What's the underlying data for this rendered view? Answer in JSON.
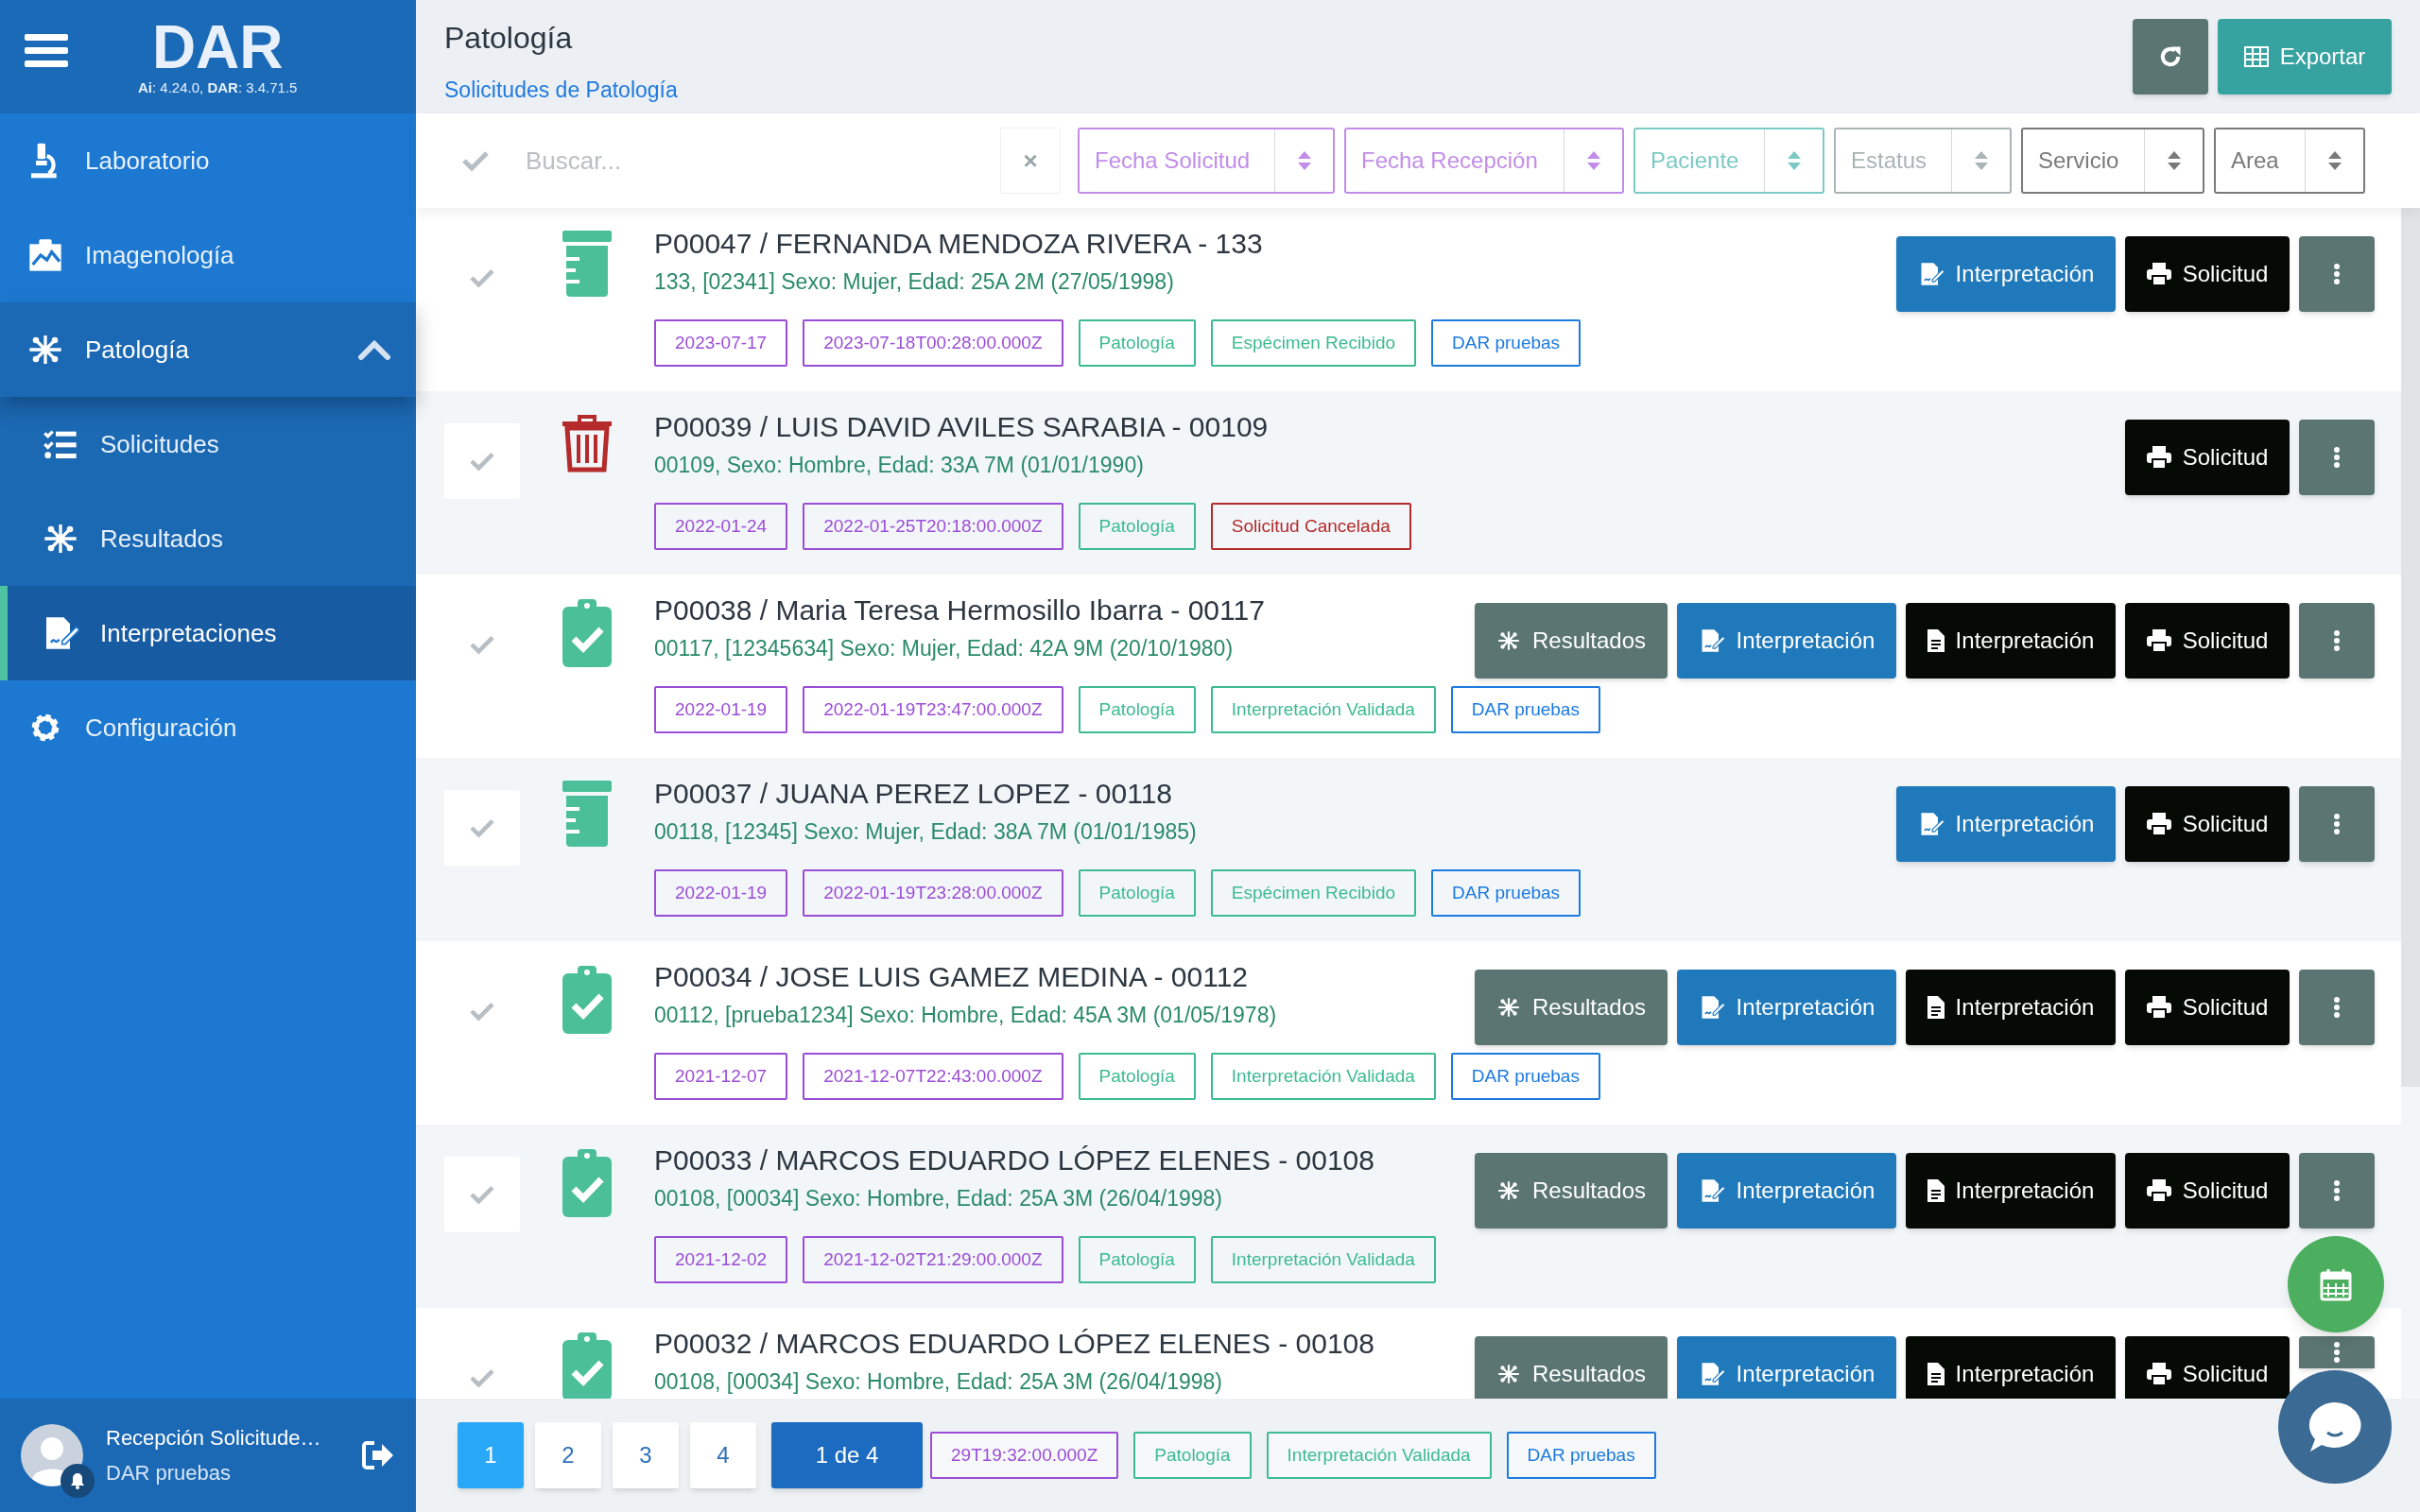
{
  "sidebar": {
    "logo": "DAR",
    "version": "**Ai**: 4.24.0, **DAR**: 3.4.71.5",
    "items": [
      {
        "kind": "laboratory",
        "label": "Laboratorio",
        "selected": false
      },
      {
        "kind": "imaging",
        "label": "Imagenología",
        "selected": false
      },
      {
        "kind": "pathology",
        "label": "Patología",
        "selected": false,
        "expanded": true,
        "children": [
          {
            "kind": "requests",
            "label": "Solicitudes",
            "selected": false
          },
          {
            "kind": "results",
            "label": "Resultados",
            "selected": false
          },
          {
            "kind": "interpretations",
            "label": "Interpretaciones",
            "selected": true
          }
        ]
      },
      {
        "kind": "settings",
        "label": "Configuración",
        "selected": false
      }
    ],
    "user": {
      "name": "Recepción Solicitude…",
      "group": "DAR pruebas"
    }
  },
  "header": {
    "title": "Patología",
    "breadcrumb": "Solicitudes de Patología",
    "export_label": "Exportar"
  },
  "filters": {
    "search_placeholder": "Buscar...",
    "clear": "×",
    "sorts": [
      {
        "label": "Fecha Solicitud",
        "color": "#c28de8"
      },
      {
        "label": "Fecha Recepción",
        "color": "#c28de8"
      },
      {
        "label": "Paciente",
        "color": "#7ccac5"
      },
      {
        "label": "Estatus",
        "color": "#aab4b4"
      },
      {
        "label": "Servicio",
        "color": "#7a7a7a"
      },
      {
        "label": "Area",
        "color": "#7a7a7a"
      }
    ]
  },
  "rows": [
    {
      "kind": "specimen",
      "checked": false,
      "title": "P00047 / FERNANDA MENDOZA RIVERA - 133",
      "subtitle": "133, [02341] Sexo: Mujer, Edad: 25A 2M (27/05/1998)",
      "tags": [
        {
          "text": "2023-07-17",
          "color": "#9b4dd6"
        },
        {
          "text": "2023-07-18T00:28:00.000Z",
          "color": "#9b4dd6"
        },
        {
          "text": "Patología",
          "color": "#3dbb92"
        },
        {
          "text": "Espécimen Recibido",
          "color": "#3dbb92"
        },
        {
          "text": "DAR pruebas",
          "color": "#1d7ae0"
        }
      ],
      "buttons": [
        {
          "kind": "interpret",
          "label": "Interpretación"
        },
        {
          "kind": "request",
          "label": "Solicitud"
        },
        {
          "kind": "more"
        }
      ]
    },
    {
      "kind": "cancelled",
      "checked": false,
      "title": "P00039 / LUIS DAVID AVILES SARABIA - 00109",
      "subtitle": "00109, Sexo: Hombre, Edad: 33A 7M (01/01/1990)",
      "tags": [
        {
          "text": "2022-01-24",
          "color": "#9b4dd6"
        },
        {
          "text": "2022-01-25T20:18:00.000Z",
          "color": "#9b4dd6"
        },
        {
          "text": "Patología",
          "color": "#3dbb92"
        },
        {
          "text": "Solicitud Cancelada",
          "color": "#b52a2a"
        }
      ],
      "buttons": [
        {
          "kind": "request",
          "label": "Solicitud"
        },
        {
          "kind": "more"
        }
      ]
    },
    {
      "kind": "validated",
      "checked": false,
      "title": "P00038 / Maria Teresa Hermosillo Ibarra - 00117",
      "subtitle": "00117, [12345634] Sexo: Mujer, Edad: 42A 9M (20/10/1980)",
      "tags": [
        {
          "text": "2022-01-19",
          "color": "#9b4dd6"
        },
        {
          "text": "2022-01-19T23:47:00.000Z",
          "color": "#9b4dd6"
        },
        {
          "text": "Patología",
          "color": "#3dbb92"
        },
        {
          "text": "Interpretación Validada",
          "color": "#3dbb92"
        },
        {
          "text": "DAR pruebas",
          "color": "#1d7ae0"
        }
      ],
      "buttons": [
        {
          "kind": "results",
          "label": "Resultados"
        },
        {
          "kind": "interpret",
          "label": "Interpretación"
        },
        {
          "kind": "view",
          "label": "Interpretación"
        },
        {
          "kind": "request",
          "label": "Solicitud"
        },
        {
          "kind": "more"
        }
      ]
    },
    {
      "kind": "specimen",
      "checked": false,
      "title": "P00037 / JUANA PEREZ LOPEZ - 00118",
      "subtitle": "00118, [12345] Sexo: Mujer, Edad: 38A 7M (01/01/1985)",
      "tags": [
        {
          "text": "2022-01-19",
          "color": "#9b4dd6"
        },
        {
          "text": "2022-01-19T23:28:00.000Z",
          "color": "#9b4dd6"
        },
        {
          "text": "Patología",
          "color": "#3dbb92"
        },
        {
          "text": "Espécimen Recibido",
          "color": "#3dbb92"
        },
        {
          "text": "DAR pruebas",
          "color": "#1d7ae0"
        }
      ],
      "buttons": [
        {
          "kind": "interpret",
          "label": "Interpretación"
        },
        {
          "kind": "request",
          "label": "Solicitud"
        },
        {
          "kind": "more"
        }
      ]
    },
    {
      "kind": "validated",
      "checked": false,
      "title": "P00034 / JOSE LUIS GAMEZ MEDINA - 00112",
      "subtitle": "00112, [prueba1234] Sexo: Hombre, Edad: 45A 3M (01/05/1978)",
      "tags": [
        {
          "text": "2021-12-07",
          "color": "#9b4dd6"
        },
        {
          "text": "2021-12-07T22:43:00.000Z",
          "color": "#9b4dd6"
        },
        {
          "text": "Patología",
          "color": "#3dbb92"
        },
        {
          "text": "Interpretación Validada",
          "color": "#3dbb92"
        },
        {
          "text": "DAR pruebas",
          "color": "#1d7ae0"
        }
      ],
      "buttons": [
        {
          "kind": "results",
          "label": "Resultados"
        },
        {
          "kind": "interpret",
          "label": "Interpretación"
        },
        {
          "kind": "view",
          "label": "Interpretación"
        },
        {
          "kind": "request",
          "label": "Solicitud"
        },
        {
          "kind": "more"
        }
      ]
    },
    {
      "kind": "validated",
      "checked": false,
      "title": "P00033 / MARCOS EDUARDO LÓPEZ ELENES - 00108",
      "subtitle": "00108, [00034] Sexo: Hombre, Edad: 25A 3M (26/04/1998)",
      "tags": [
        {
          "text": "2021-12-02",
          "color": "#9b4dd6"
        },
        {
          "text": "2021-12-02T21:29:00.000Z",
          "color": "#9b4dd6"
        },
        {
          "text": "Patología",
          "color": "#3dbb92"
        },
        {
          "text": "Interpretación Validada",
          "color": "#3dbb92"
        }
      ],
      "buttons": [
        {
          "kind": "results",
          "label": "Resultados"
        },
        {
          "kind": "interpret",
          "label": "Interpretación"
        },
        {
          "kind": "view",
          "label": "Interpretación"
        },
        {
          "kind": "request",
          "label": "Solicitud"
        },
        {
          "kind": "more"
        }
      ]
    },
    {
      "kind": "validated",
      "checked": false,
      "title": "P00032 / MARCOS EDUARDO LÓPEZ ELENES - 00108",
      "subtitle": "00108, [00034] Sexo: Hombre, Edad: 25A 3M (26/04/1998)",
      "tags": [
        {
          "text": "29T19:32:00.000Z",
          "color": "#9b4dd6"
        },
        {
          "text": "Patología",
          "color": "#3dbb92"
        },
        {
          "text": "Interpretación Validada",
          "color": "#3dbb92"
        },
        {
          "text": "DAR pruebas",
          "color": "#1d7ae0"
        }
      ],
      "buttons": [
        {
          "kind": "results",
          "label": "Resultados"
        },
        {
          "kind": "interpret",
          "label": "Interpretación"
        },
        {
          "kind": "view",
          "label": "Interpretación"
        },
        {
          "kind": "request",
          "label": "Solicitud"
        },
        {
          "kind": "more"
        }
      ]
    }
  ],
  "pagination": {
    "pages": [
      {
        "label": "1",
        "selected": true
      },
      {
        "label": "2",
        "selected": false
      },
      {
        "label": "3",
        "selected": false
      },
      {
        "label": "4",
        "selected": false
      }
    ],
    "summary": "1 de 4"
  }
}
